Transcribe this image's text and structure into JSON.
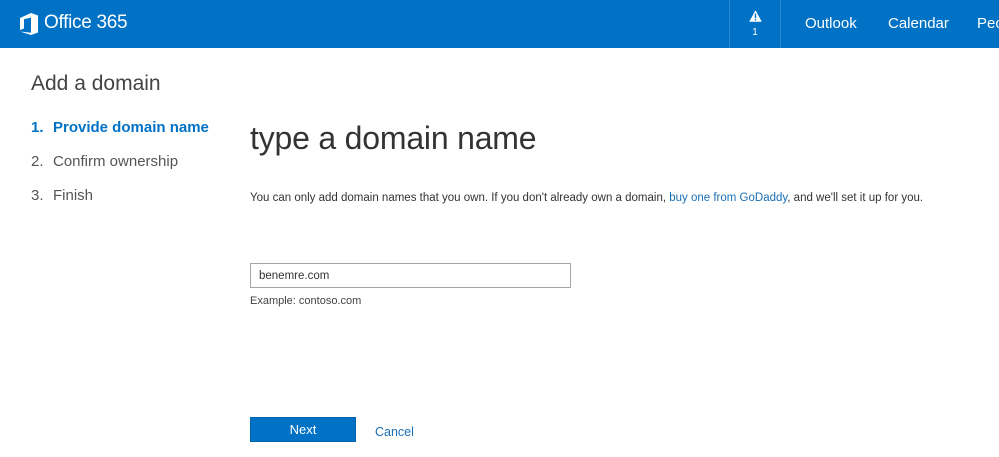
{
  "topbar": {
    "brand": "Office 365",
    "alert_count": "1",
    "nav": {
      "outlook": "Outlook",
      "calendar": "Calendar",
      "people": "People"
    }
  },
  "wizard": {
    "heading": "Add a domain",
    "steps": [
      {
        "num": "1.",
        "label": "Provide domain name",
        "active": true
      },
      {
        "num": "2.",
        "label": "Confirm ownership",
        "active": false
      },
      {
        "num": "3.",
        "label": "Finish",
        "active": false
      }
    ]
  },
  "main": {
    "title": "type a domain name",
    "desc_before": "You can only add domain names that you own. If you don't already own a domain, ",
    "desc_link": "buy one from GoDaddy",
    "desc_after": ", and we'll set it up for you.",
    "domain_value": "benemre.com",
    "example": "Example: contoso.com",
    "next_label": "Next",
    "cancel_label": "Cancel"
  },
  "colors": {
    "brand_blue": "#0072c6",
    "link_blue": "#1a6fb5"
  },
  "icons": {
    "brand": "office-logo-icon",
    "alert": "warning-triangle-icon"
  }
}
